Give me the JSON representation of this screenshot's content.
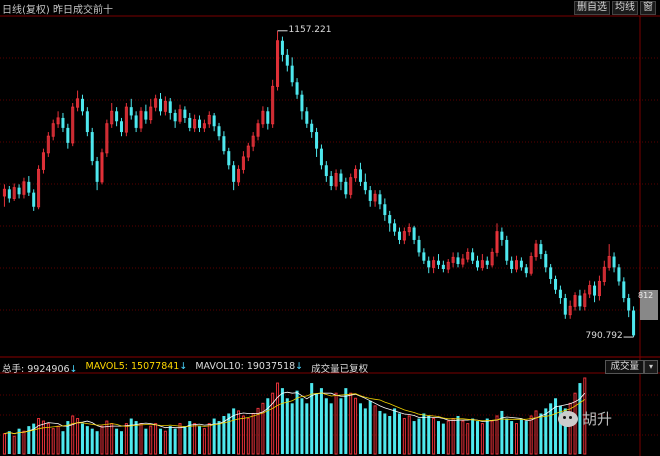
{
  "header": {
    "title": "日线(复权)  昨日成交前十",
    "buttons": [
      "删自选",
      "均线",
      "窗"
    ]
  },
  "legend": {
    "total_label": "总手: ",
    "total_value": "9924906",
    "mavol5_label": "MAVOL5: ",
    "mavol5_value": "15077841",
    "mavol10_label": "MAVOL10: ",
    "mavol10_value": "19037518",
    "note": "成交量已复权"
  },
  "volume_tab": {
    "label": "成交量",
    "dropdown": "▾"
  },
  "price_tag": {
    "value": "812"
  },
  "watermark": "胡升",
  "colors": {
    "up": "#e8323a",
    "down": "#4ee8ee",
    "bg": "#000000",
    "grid": "#5a0000",
    "ma5": "#ffffff",
    "ma10": "#f0d000"
  },
  "chart_data": {
    "type": "candlestick",
    "high_label": "1157.221",
    "low_label": "790.792",
    "price_range": [
      770,
      1170
    ],
    "candles": [
      [
        958,
        966,
        945,
        972
      ],
      [
        966,
        955,
        950,
        970
      ],
      [
        955,
        968,
        952,
        973
      ],
      [
        968,
        960,
        955,
        972
      ],
      [
        960,
        975,
        955,
        980
      ],
      [
        975,
        962,
        958,
        982
      ],
      [
        962,
        945,
        940,
        966
      ],
      [
        945,
        990,
        942,
        995
      ],
      [
        990,
        1010,
        985,
        1015
      ],
      [
        1010,
        1030,
        1005,
        1035
      ],
      [
        1030,
        1045,
        1025,
        1050
      ],
      [
        1045,
        1052,
        1040,
        1060
      ],
      [
        1052,
        1040,
        1035,
        1058
      ],
      [
        1040,
        1022,
        1015,
        1045
      ],
      [
        1022,
        1065,
        1018,
        1070
      ],
      [
        1065,
        1075,
        1060,
        1085
      ],
      [
        1075,
        1060,
        1055,
        1080
      ],
      [
        1060,
        1035,
        1030,
        1065
      ],
      [
        1035,
        1000,
        995,
        1040
      ],
      [
        1000,
        975,
        965,
        1005
      ],
      [
        975,
        1010,
        972,
        1015
      ],
      [
        1010,
        1045,
        1005,
        1050
      ],
      [
        1045,
        1060,
        1040,
        1070
      ],
      [
        1060,
        1048,
        1042,
        1065
      ],
      [
        1048,
        1035,
        1030,
        1052
      ],
      [
        1035,
        1065,
        1030,
        1070
      ],
      [
        1065,
        1055,
        1050,
        1075
      ],
      [
        1055,
        1040,
        1035,
        1060
      ],
      [
        1040,
        1060,
        1035,
        1065
      ],
      [
        1060,
        1050,
        1045,
        1068
      ],
      [
        1050,
        1065,
        1045,
        1075
      ],
      [
        1065,
        1075,
        1060,
        1080
      ],
      [
        1075,
        1060,
        1055,
        1082
      ],
      [
        1060,
        1072,
        1055,
        1078
      ],
      [
        1072,
        1058,
        1050,
        1076
      ],
      [
        1058,
        1048,
        1040,
        1062
      ],
      [
        1048,
        1062,
        1045,
        1068
      ],
      [
        1062,
        1052,
        1046,
        1066
      ],
      [
        1052,
        1040,
        1036,
        1058
      ],
      [
        1040,
        1050,
        1035,
        1056
      ],
      [
        1050,
        1040,
        1035,
        1055
      ],
      [
        1040,
        1045,
        1035,
        1050
      ],
      [
        1045,
        1055,
        1040,
        1060
      ],
      [
        1055,
        1042,
        1036,
        1058
      ],
      [
        1042,
        1030,
        1025,
        1046
      ],
      [
        1030,
        1012,
        1008,
        1036
      ],
      [
        1012,
        995,
        990,
        1016
      ],
      [
        995,
        975,
        965,
        1000
      ],
      [
        975,
        990,
        970,
        995
      ],
      [
        990,
        1005,
        985,
        1012
      ],
      [
        1005,
        1018,
        1000,
        1022
      ],
      [
        1018,
        1030,
        1012,
        1035
      ],
      [
        1030,
        1045,
        1025,
        1050
      ],
      [
        1045,
        1060,
        1040,
        1066
      ],
      [
        1060,
        1045,
        1038,
        1065
      ],
      [
        1045,
        1090,
        1040,
        1098
      ],
      [
        1090,
        1145,
        1085,
        1157
      ],
      [
        1145,
        1128,
        1120,
        1150
      ],
      [
        1128,
        1115,
        1108,
        1135
      ],
      [
        1115,
        1095,
        1090,
        1125
      ],
      [
        1095,
        1080,
        1075,
        1100
      ],
      [
        1080,
        1060,
        1050,
        1085
      ],
      [
        1060,
        1045,
        1040,
        1065
      ],
      [
        1045,
        1035,
        1028,
        1050
      ],
      [
        1035,
        1015,
        1005,
        1040
      ],
      [
        1015,
        995,
        990,
        1020
      ],
      [
        995,
        982,
        975,
        1000
      ],
      [
        982,
        970,
        965,
        988
      ],
      [
        970,
        985,
        965,
        990
      ],
      [
        985,
        975,
        965,
        990
      ],
      [
        975,
        960,
        955,
        980
      ],
      [
        960,
        980,
        955,
        985
      ],
      [
        980,
        990,
        975,
        995
      ],
      [
        990,
        975,
        970,
        998
      ],
      [
        975,
        965,
        960,
        985
      ],
      [
        965,
        952,
        945,
        970
      ],
      [
        952,
        960,
        945,
        965
      ],
      [
        960,
        948,
        942,
        965
      ],
      [
        948,
        935,
        928,
        955
      ],
      [
        935,
        925,
        915,
        940
      ],
      [
        925,
        915,
        910,
        930
      ],
      [
        915,
        905,
        900,
        920
      ],
      [
        905,
        915,
        900,
        920
      ],
      [
        915,
        920,
        910,
        925
      ],
      [
        920,
        905,
        900,
        922
      ],
      [
        905,
        890,
        885,
        910
      ],
      [
        890,
        880,
        876,
        895
      ],
      [
        880,
        872,
        865,
        885
      ],
      [
        872,
        880,
        865,
        885
      ],
      [
        880,
        875,
        870,
        888
      ],
      [
        875,
        870,
        866,
        880
      ],
      [
        870,
        878,
        865,
        882
      ],
      [
        878,
        884,
        872,
        890
      ],
      [
        884,
        876,
        872,
        890
      ],
      [
        876,
        882,
        872,
        888
      ],
      [
        882,
        890,
        878,
        895
      ],
      [
        890,
        880,
        876,
        895
      ],
      [
        880,
        872,
        868,
        886
      ],
      [
        872,
        880,
        868,
        888
      ],
      [
        880,
        875,
        870,
        885
      ],
      [
        875,
        890,
        872,
        895
      ],
      [
        890,
        915,
        885,
        925
      ],
      [
        915,
        905,
        898,
        920
      ],
      [
        905,
        880,
        875,
        910
      ],
      [
        880,
        870,
        865,
        885
      ],
      [
        870,
        880,
        866,
        886
      ],
      [
        880,
        872,
        868,
        884
      ],
      [
        872,
        865,
        860,
        876
      ],
      [
        865,
        885,
        862,
        890
      ],
      [
        885,
        900,
        880,
        905
      ],
      [
        900,
        888,
        882,
        905
      ],
      [
        888,
        872,
        866,
        892
      ],
      [
        872,
        858,
        852,
        876
      ],
      [
        858,
        845,
        840,
        862
      ],
      [
        845,
        835,
        828,
        850
      ],
      [
        835,
        815,
        810,
        840
      ],
      [
        815,
        825,
        810,
        832
      ],
      [
        825,
        838,
        820,
        842
      ],
      [
        838,
        825,
        820,
        845
      ],
      [
        825,
        840,
        820,
        845
      ],
      [
        840,
        850,
        835,
        856
      ],
      [
        850,
        838,
        830,
        855
      ],
      [
        838,
        855,
        832,
        862
      ],
      [
        855,
        872,
        850,
        880
      ],
      [
        872,
        885,
        868,
        900
      ],
      [
        885,
        872,
        866,
        890
      ],
      [
        872,
        855,
        850,
        876
      ],
      [
        855,
        835,
        830,
        860
      ],
      [
        835,
        820,
        812,
        840
      ],
      [
        820,
        790,
        788,
        825
      ]
    ],
    "volumes": [
      8,
      9,
      7,
      10,
      9,
      11,
      12,
      14,
      13,
      12,
      10,
      11,
      9,
      13,
      15,
      14,
      12,
      11,
      10,
      9,
      11,
      13,
      12,
      10,
      9,
      12,
      14,
      13,
      12,
      10,
      11,
      12,
      10,
      9,
      11,
      10,
      12,
      11,
      13,
      12,
      11,
      10,
      12,
      14,
      13,
      15,
      16,
      18,
      17,
      15,
      14,
      16,
      18,
      20,
      22,
      24,
      28,
      26,
      22,
      20,
      25,
      22,
      20,
      28,
      24,
      26,
      22,
      20,
      24,
      22,
      26,
      24,
      22,
      20,
      18,
      21,
      19,
      17,
      16,
      15,
      18,
      16,
      14,
      15,
      13,
      14,
      16,
      15,
      14,
      13,
      12,
      13,
      14,
      15,
      13,
      12,
      14,
      13,
      12,
      14,
      13,
      15,
      17,
      14,
      13,
      12,
      14,
      13,
      15,
      17,
      16,
      18,
      20,
      22,
      19,
      18,
      20,
      24,
      28,
      30
    ]
  }
}
